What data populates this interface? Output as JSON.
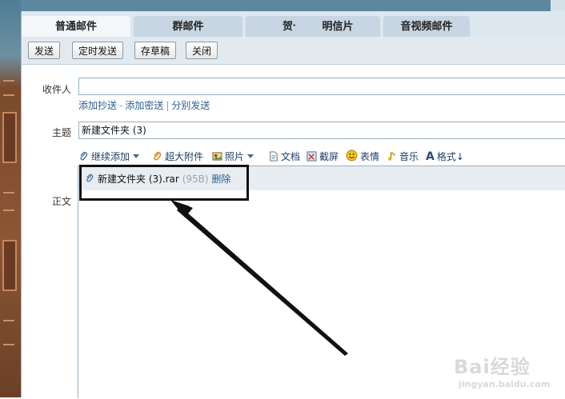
{
  "tabs": [
    {
      "label": "普通邮件",
      "active": true
    },
    {
      "label": "群邮件",
      "active": false
    },
    {
      "label": "贺卡",
      "active": false
    },
    {
      "label": "明信片",
      "active": false
    },
    {
      "label": "音视频邮件",
      "active": false
    }
  ],
  "toolbar": {
    "send": "发送",
    "scheduled_send": "定时发送",
    "save_draft": "存草稿",
    "close": "关闭"
  },
  "recipient": {
    "label": "收件人",
    "value": ""
  },
  "recipient_links": {
    "add_cc": "添加抄送",
    "dash": "-",
    "add_bcc": "添加密送",
    "pipe": "|",
    "separate_send": "分别发送"
  },
  "subject": {
    "label": "主题",
    "value": "新建文件夹 (3)"
  },
  "attach_bar": {
    "continue_add": "继续添加",
    "super_attachment": "超大附件",
    "photo": "照片",
    "document": "文档",
    "screenshot": "截屏",
    "emoji": "表情",
    "music": "音乐",
    "format": "格式↓"
  },
  "body": {
    "label": "正文"
  },
  "attachment": {
    "filename": "新建文件夹 (3).rar",
    "size": "(95B)",
    "delete": "删除"
  },
  "watermark": {
    "brand": "Bai经验",
    "url": "jingyan.baidu.com"
  },
  "colors": {
    "accent_link": "#2a5d8e",
    "tab_bg": "#c7d6e2",
    "toolbar_bg": "#e2eaf0"
  }
}
